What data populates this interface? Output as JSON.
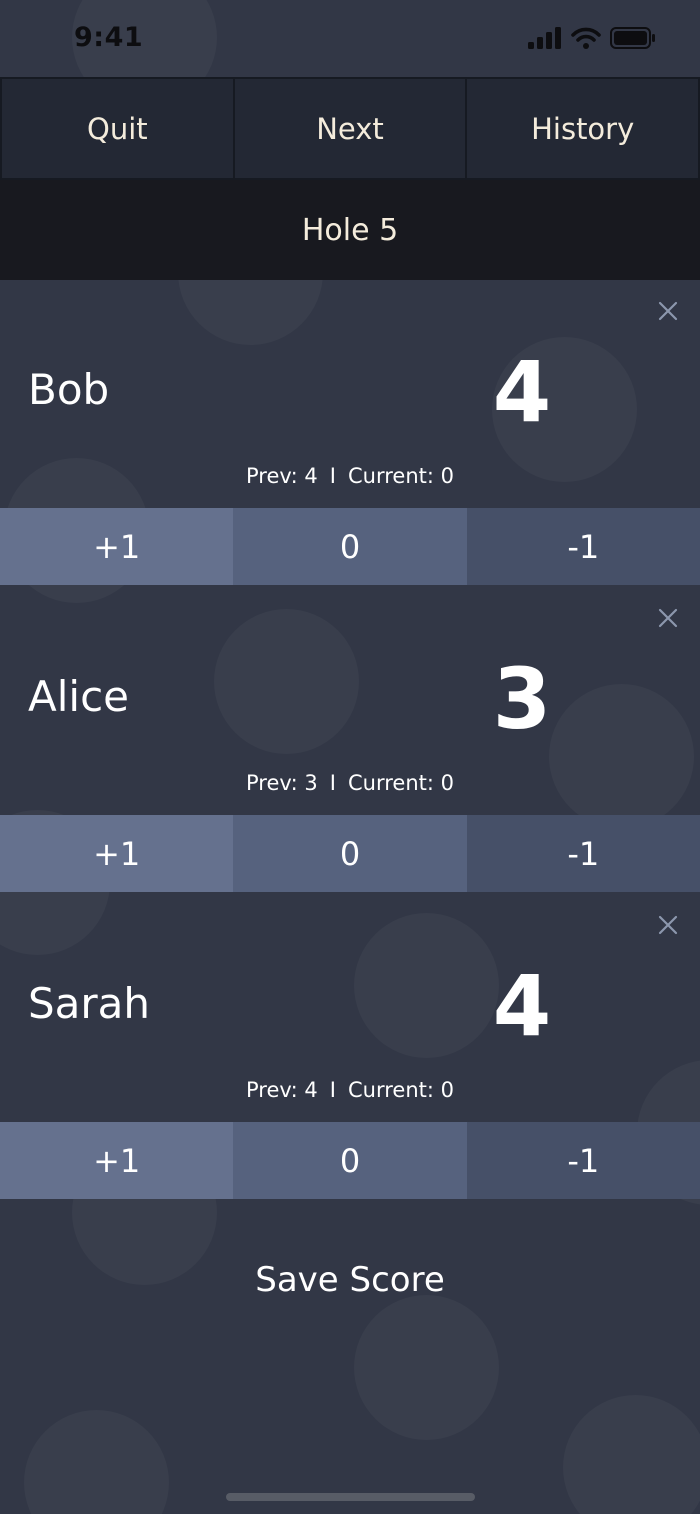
{
  "status_bar": {
    "time": "9:41"
  },
  "nav": {
    "quit_label": "Quit",
    "next_label": "Next",
    "history_label": "History"
  },
  "hole": {
    "label": "Hole 5"
  },
  "players": [
    {
      "name": "Bob",
      "score": "4",
      "prev_label": "Prev: 4",
      "current_label": "Current: 0",
      "separator": "I"
    },
    {
      "name": "Alice",
      "score": "3",
      "prev_label": "Prev: 3",
      "current_label": "Current: 0",
      "separator": "I"
    },
    {
      "name": "Sarah",
      "score": "4",
      "prev_label": "Prev: 4",
      "current_label": "Current: 0",
      "separator": "I"
    }
  ],
  "controls": {
    "plus_label": "+1",
    "zero_label": "0",
    "minus_label": "-1"
  },
  "save": {
    "label": "Save Score"
  },
  "icons": {
    "signal": "cellular-signal-icon",
    "wifi": "wifi-icon",
    "battery": "battery-icon",
    "remove": "close-icon"
  },
  "colors": {
    "background": "#323746",
    "nav_button": "#232834",
    "hole_bar": "#18191f",
    "plus_button": "#65718e",
    "zero_button": "#56627e",
    "minus_button": "#465068",
    "text": "#f4f1ea"
  }
}
